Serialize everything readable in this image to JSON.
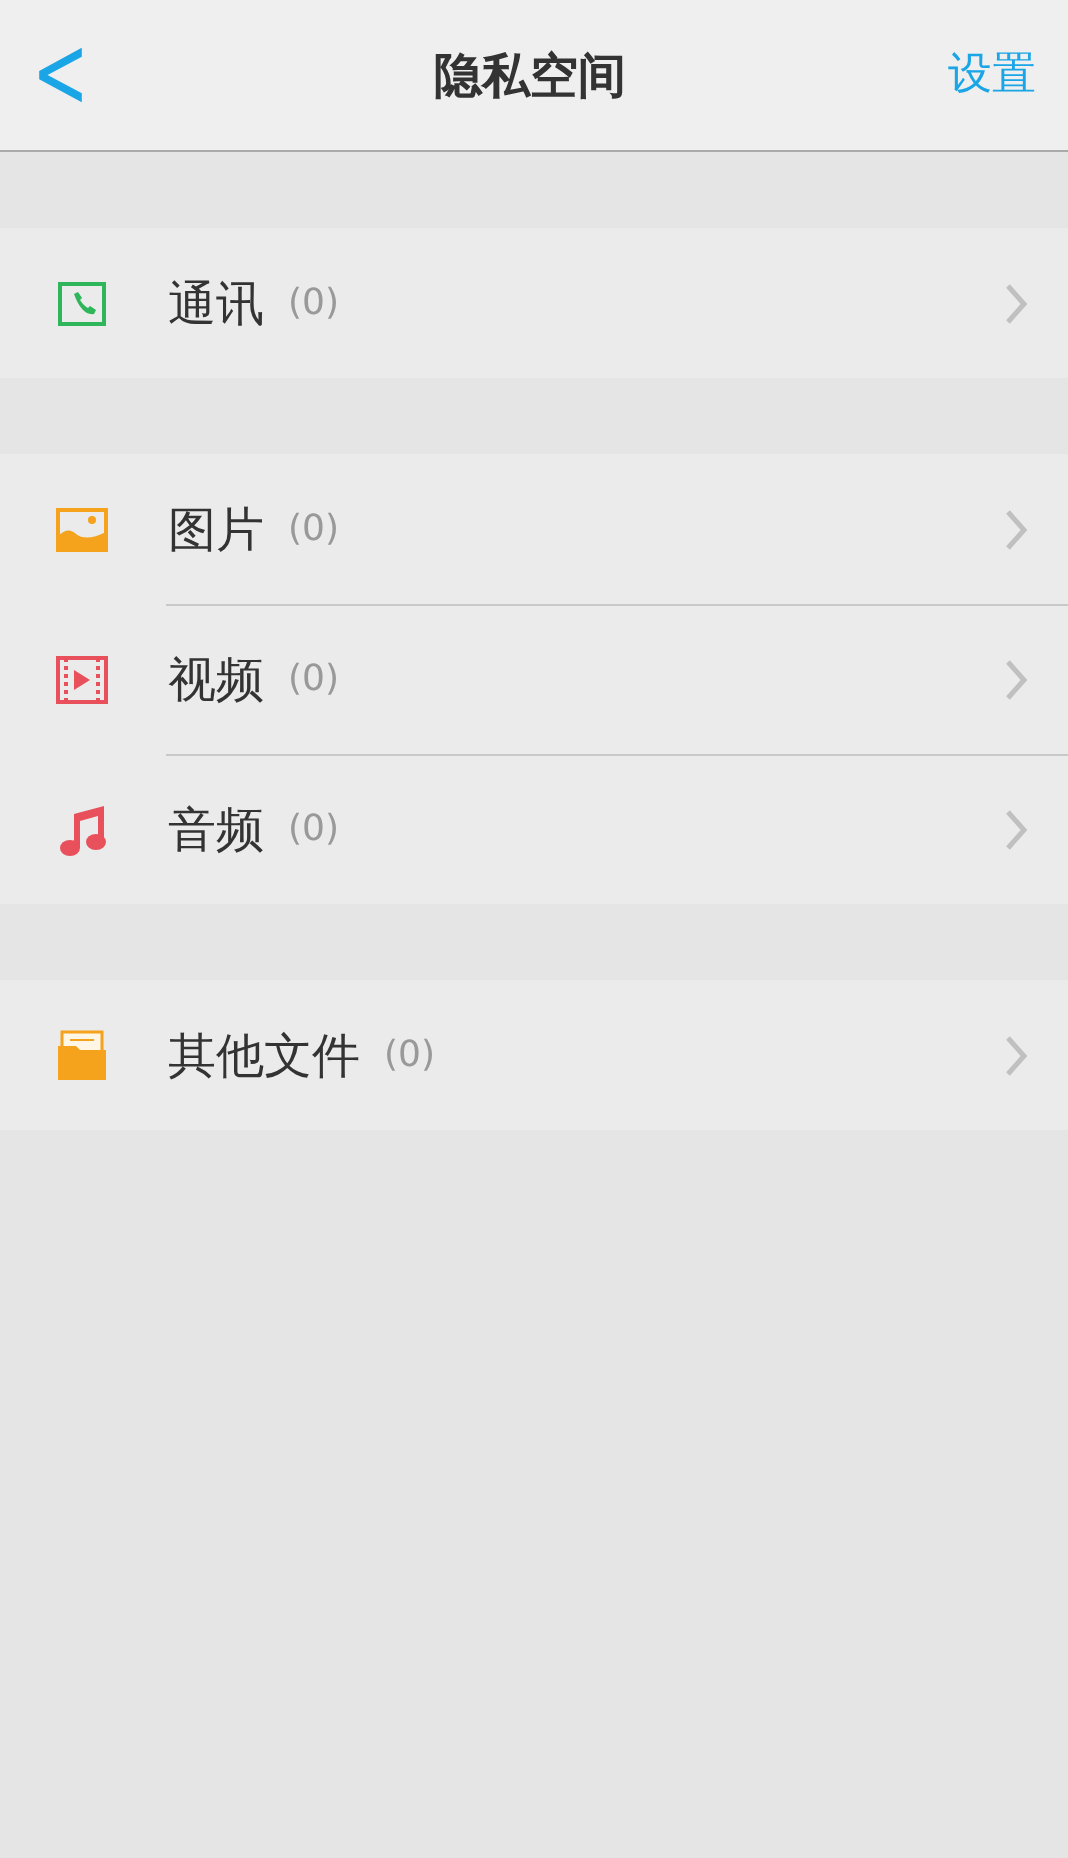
{
  "header": {
    "back": "<",
    "title": "隐私空间",
    "action": "设置"
  },
  "groups": [
    {
      "items": [
        {
          "kind": "contacts",
          "label": "通讯",
          "count": "(0)"
        }
      ]
    },
    {
      "items": [
        {
          "kind": "image",
          "label": "图片",
          "count": "(0)"
        },
        {
          "kind": "video",
          "label": "视频",
          "count": "(0)"
        },
        {
          "kind": "audio",
          "label": "音频",
          "count": "(0)"
        }
      ]
    },
    {
      "items": [
        {
          "kind": "folder",
          "label": "其他文件",
          "count": "(0)"
        }
      ]
    }
  ]
}
